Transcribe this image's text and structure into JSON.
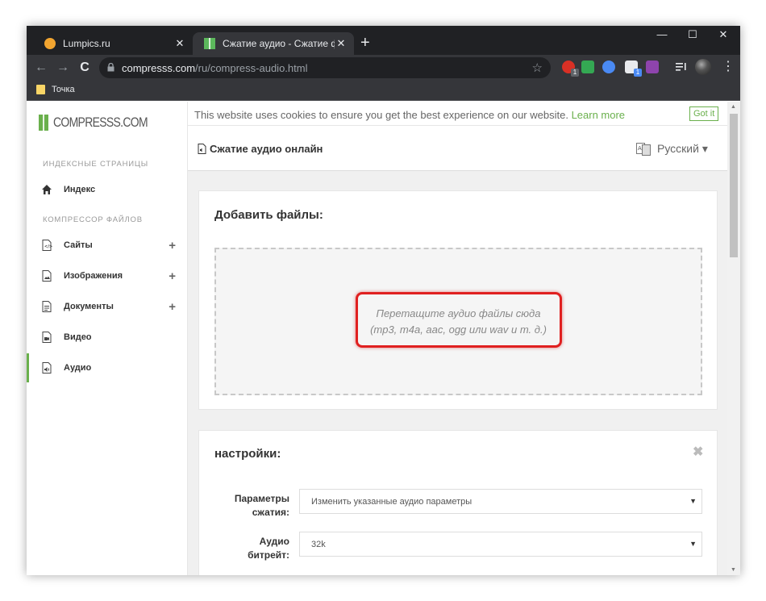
{
  "browser": {
    "tabs": [
      {
        "title": "Lumpics.ru",
        "active": false
      },
      {
        "title": "Сжатие аудио - Сжатие файлов",
        "active": true
      }
    ],
    "new_tab": "+",
    "close_glyph": "✕",
    "window_controls": {
      "minimize": "—",
      "maximize": "☐",
      "close": "✕"
    },
    "nav": {
      "back": "←",
      "forward": "→",
      "reload": "C"
    },
    "url_host": "compresss.com",
    "url_path": "/ru/compress-audio.html",
    "star": "☆",
    "menu": "⋮",
    "extensions": [
      {
        "icon": "opera-red-icon",
        "color": "#d93025",
        "badge": "1"
      },
      {
        "icon": "check-green-icon",
        "color": "#34a853",
        "badge": ""
      },
      {
        "icon": "globe-blue-icon",
        "color": "#4a8af4",
        "badge": ""
      },
      {
        "icon": "box-icon",
        "color": "#e8eaed",
        "badge": "1"
      },
      {
        "icon": "purple-ext-icon",
        "color": "#8e44ad",
        "badge": ""
      },
      {
        "icon": "playlist-icon",
        "color": "#e8eaed",
        "badge": ""
      }
    ],
    "bookmarks": [
      {
        "label": "Точка"
      }
    ]
  },
  "site": {
    "logo_text": "COMPRESSS.COM",
    "sidebar": {
      "section1": "ИНДЕКСНЫЕ СТРАНИЦЫ",
      "index": "Индекс",
      "section2": "КОМПРЕССОР ФАЙЛОВ",
      "items": [
        {
          "label": "Сайты",
          "plus": "+"
        },
        {
          "label": "Изображения",
          "plus": "+"
        },
        {
          "label": "Документы",
          "plus": "+"
        },
        {
          "label": "Видео",
          "plus": ""
        },
        {
          "label": "Аудио",
          "plus": ""
        }
      ]
    },
    "cookie": {
      "text": "This website uses cookies to ensure you get the best experience on our website.",
      "link": "Learn more",
      "button": "Got it"
    },
    "page_title": "Сжатие аудио онлайн",
    "language": "Русский ▾",
    "upload": {
      "title": "Добавить файлы:",
      "hint_line1": "Перетащите аудио файлы сюда",
      "hint_line2": "(mp3, m4a, aac, ogg или wav и т. д.)"
    },
    "settings": {
      "title": "настройки:",
      "close": "✖",
      "fields": [
        {
          "label_line1": "Параметры",
          "label_line2": "сжатия:",
          "value": "Изменить указанные аудио параметры"
        },
        {
          "label_line1": "Аудио",
          "label_line2": "битрейт:",
          "value": "32k"
        }
      ],
      "caret": "▼"
    }
  },
  "colors": {
    "accent": "#6ab04c",
    "highlight": "#e02020",
    "chrome_dark": "#202124",
    "chrome_toolbar": "#35363a"
  }
}
